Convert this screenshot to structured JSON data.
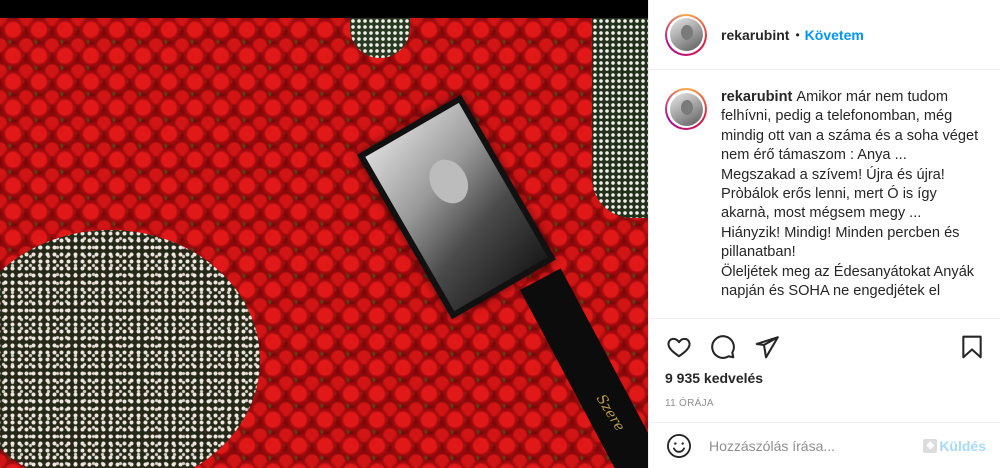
{
  "post": {
    "username": "rekarubint",
    "header_separator": "•",
    "follow_label": "Követem",
    "caption": "Amikor már nem tudom felhívni, pedig a telefonomban, még mindig ott van a száma és a soha véget nem érő támaszom : Anya ...\nMegszakad a szívem! Újra és újra!\nPròbálok erős lenni, mert Ó is így akarnà, most mégsem megy ...\nHiányzik! Mindig! Minden percben és pillanatban!\nÖleljétek meg az Édesanyátokat Anyák napján és SOHA ne engedjétek el",
    "likes": "9 935 kedvelés",
    "time": "11 ÓRÁJA"
  },
  "photo": {
    "ribbon_text": "Szere"
  },
  "actions": {
    "like_icon": "heart-icon",
    "comment_icon": "comment-bubble-icon",
    "share_icon": "paper-plane-icon",
    "save_icon": "bookmark-icon"
  },
  "comment": {
    "placeholder": "Hozzászólás írása...",
    "send_label": "Küldés",
    "emoji_icon": "smiley-icon"
  },
  "colors": {
    "link": "#0095f6",
    "text": "#262626",
    "muted": "#8e8e8e",
    "rose_red": "#c81212"
  }
}
